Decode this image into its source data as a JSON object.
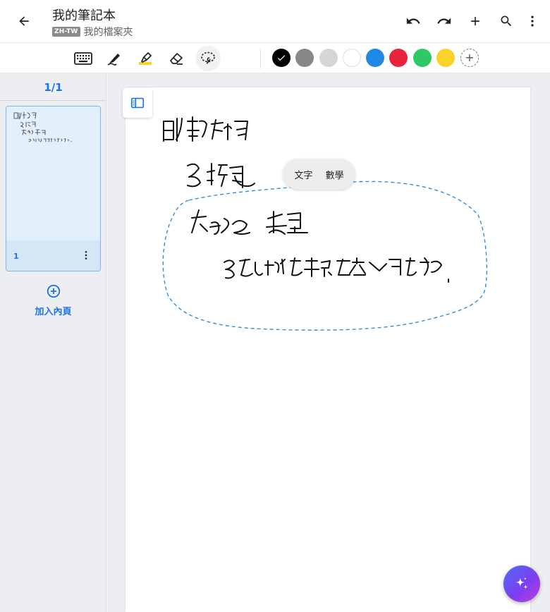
{
  "header": {
    "title": "我的筆記本",
    "language_badge": "ZH-TW",
    "folder_name": "我的檔案夾",
    "icons": [
      "back-arrow-icon",
      "undo-icon",
      "redo-icon",
      "add-icon",
      "search-icon",
      "more-vert-icon"
    ]
  },
  "toolbar": {
    "tools": [
      "keyboard-icon",
      "pen-icon",
      "highlighter-icon",
      "eraser-icon",
      "lasso-icon"
    ],
    "active_tool": "lasso-icon",
    "colors": [
      "#000000",
      "#888888",
      "#d6d6d6",
      "#ffffff",
      "#1e88e5",
      "#e8243c",
      "#2ec866",
      "#fbd22a"
    ],
    "selected_color": "#000000"
  },
  "sidebar": {
    "page_count": "1/1",
    "pages": [
      {
        "number": "1"
      }
    ],
    "add_page_label": "加入內頁"
  },
  "selection_menu": {
    "text_option": "文字",
    "math_option": "數學"
  },
  "accent_color": "#1a73e8"
}
